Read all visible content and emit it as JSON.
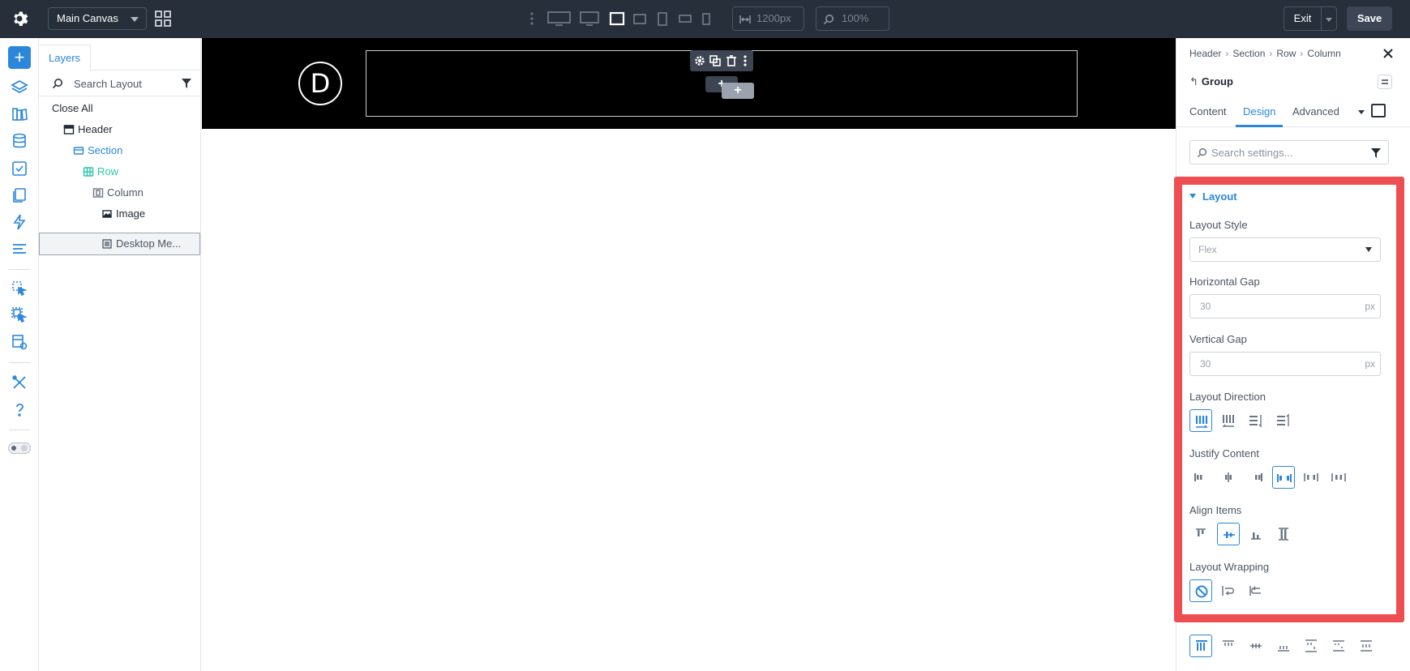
{
  "topbar": {
    "canvas_select": "Main Canvas",
    "width_value": "1200px",
    "zoom_value": "100%",
    "exit_label": "Exit",
    "save_label": "Save"
  },
  "layers": {
    "tab_label": "Layers",
    "search_placeholder": "Search Layout",
    "close_all": "Close All",
    "tree": [
      {
        "label": "Header",
        "icon": "header-icon",
        "color": "#1f2933"
      },
      {
        "label": "Section",
        "icon": "section-icon",
        "color": "#2b87da"
      },
      {
        "label": "Row",
        "icon": "row-icon",
        "color": "#29c4a9"
      },
      {
        "label": "Column",
        "icon": "column-icon",
        "color": "#4a5563"
      },
      {
        "label": "Image",
        "icon": "image-icon",
        "color": "#1f2933"
      },
      {
        "label": "Desktop Me...",
        "icon": "menu-module-icon",
        "color": "#4a5563"
      }
    ]
  },
  "canvas": {
    "logo_letter": "D"
  },
  "settings": {
    "breadcrumb": [
      "Header",
      "Section",
      "Row",
      "Column"
    ],
    "group_label": "Group",
    "tabs": [
      "Content",
      "Design",
      "Advanced"
    ],
    "active_tab": "Design",
    "search_placeholder": "Search settings...",
    "section_title": "Layout",
    "layout_style_label": "Layout Style",
    "layout_style_value": "Flex",
    "horizontal_gap_label": "Horizontal Gap",
    "horizontal_gap_value": "30",
    "vertical_gap_label": "Vertical Gap",
    "vertical_gap_value": "30",
    "unit": "px",
    "layout_direction_label": "Layout Direction",
    "justify_content_label": "Justify Content",
    "align_items_label": "Align Items",
    "layout_wrapping_label": "Layout Wrapping"
  },
  "colors": {
    "accent": "#2b87da",
    "highlight": "#ee4e52",
    "topbar": "#262f3a"
  }
}
